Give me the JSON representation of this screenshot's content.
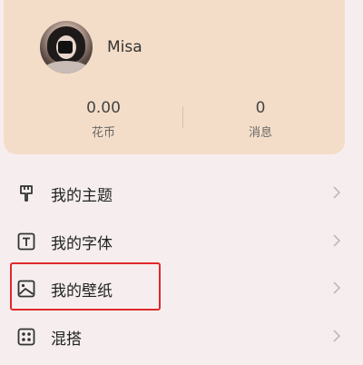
{
  "profile": {
    "username": "Misa"
  },
  "stats": {
    "coins_value": "0.00",
    "coins_label": "花币",
    "messages_value": "0",
    "messages_label": "消息"
  },
  "menu": {
    "items": [
      {
        "label": "我的主题",
        "icon": "theme-brush-icon"
      },
      {
        "label": "我的字体",
        "icon": "font-t-icon"
      },
      {
        "label": "我的壁纸",
        "icon": "wallpaper-image-icon"
      },
      {
        "label": "混搭",
        "icon": "mix-dots-icon"
      }
    ]
  },
  "colors": {
    "card_background": "#f4ddc8",
    "page_background": "#f6eeee",
    "highlight_border": "#e0282c"
  }
}
